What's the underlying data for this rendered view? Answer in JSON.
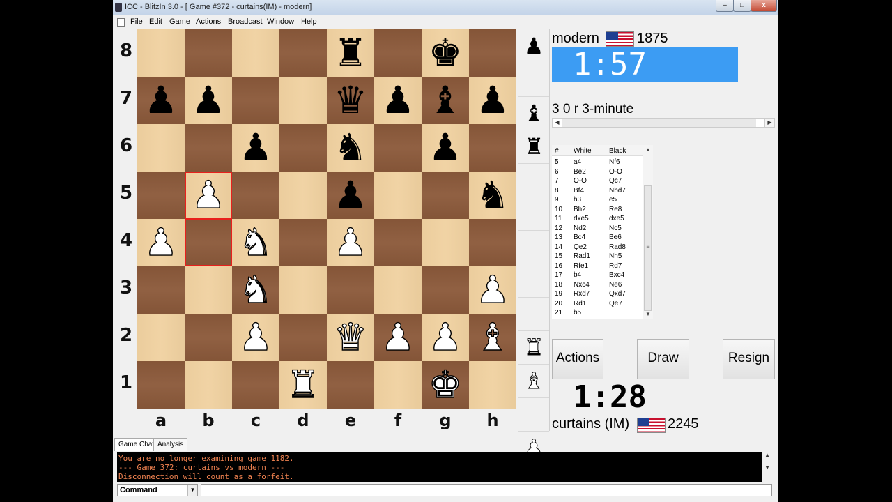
{
  "window": {
    "title": "ICC - BlitzIn 3.0 - [ Game #372 - curtains(IM) - modern]",
    "controls": {
      "minimize": "–",
      "maximize": "□",
      "close": "x"
    }
  },
  "menu": [
    "File",
    "Edit",
    "Game",
    "Actions",
    "Broadcast",
    "Window",
    "Help"
  ],
  "board": {
    "ranks": [
      "8",
      "7",
      "6",
      "5",
      "4",
      "3",
      "2",
      "1"
    ],
    "files": [
      "a",
      "b",
      "c",
      "d",
      "e",
      "f",
      "g",
      "h"
    ],
    "highlight_squares": [
      "b5",
      "b4"
    ],
    "pieces": [
      {
        "sq": "e8",
        "color": "b",
        "type": "rook"
      },
      {
        "sq": "g8",
        "color": "b",
        "type": "king"
      },
      {
        "sq": "a7",
        "color": "b",
        "type": "pawn"
      },
      {
        "sq": "b7",
        "color": "b",
        "type": "pawn"
      },
      {
        "sq": "e7",
        "color": "b",
        "type": "queen"
      },
      {
        "sq": "f7",
        "color": "b",
        "type": "pawn"
      },
      {
        "sq": "g7",
        "color": "b",
        "type": "bishop"
      },
      {
        "sq": "h7",
        "color": "b",
        "type": "pawn"
      },
      {
        "sq": "c6",
        "color": "b",
        "type": "pawn"
      },
      {
        "sq": "e6",
        "color": "b",
        "type": "knight"
      },
      {
        "sq": "g6",
        "color": "b",
        "type": "pawn"
      },
      {
        "sq": "b5",
        "color": "w",
        "type": "pawn"
      },
      {
        "sq": "e5",
        "color": "b",
        "type": "pawn"
      },
      {
        "sq": "h5",
        "color": "b",
        "type": "knight"
      },
      {
        "sq": "a4",
        "color": "w",
        "type": "pawn"
      },
      {
        "sq": "c4",
        "color": "w",
        "type": "knight"
      },
      {
        "sq": "e4",
        "color": "w",
        "type": "pawn"
      },
      {
        "sq": "c3",
        "color": "w",
        "type": "knight"
      },
      {
        "sq": "h3",
        "color": "w",
        "type": "pawn"
      },
      {
        "sq": "c2",
        "color": "w",
        "type": "pawn"
      },
      {
        "sq": "e2",
        "color": "w",
        "type": "queen"
      },
      {
        "sq": "f2",
        "color": "w",
        "type": "pawn"
      },
      {
        "sq": "g2",
        "color": "w",
        "type": "pawn"
      },
      {
        "sq": "h2",
        "color": "w",
        "type": "bishop"
      },
      {
        "sq": "d1",
        "color": "w",
        "type": "rook"
      },
      {
        "sq": "g1",
        "color": "w",
        "type": "king"
      }
    ]
  },
  "captured": {
    "top": [
      {
        "color": "b",
        "type": "pawn",
        "slot": 0
      },
      {
        "color": "b",
        "type": "bishop",
        "slot": 2
      },
      {
        "color": "b",
        "type": "rook",
        "slot": 3
      }
    ],
    "bottom": [
      {
        "color": "w",
        "type": "rook",
        "slot": 9
      },
      {
        "color": "w",
        "type": "bishop",
        "slot": 10
      },
      {
        "color": "w",
        "type": "pawn",
        "slot": 12
      }
    ]
  },
  "top_player": {
    "name": "modern",
    "flag": "us-flag",
    "rating": "1875",
    "clock": "1:57"
  },
  "bottom_player": {
    "name": "curtains (IM)",
    "flag": "us-flag",
    "rating": "2245",
    "clock": "1:28"
  },
  "game_type": "3 0 r 3-minute",
  "move_table": {
    "headers": {
      "num": "#",
      "white": "White",
      "black": "Black"
    },
    "rows": [
      {
        "num": "5",
        "white": "a4",
        "black": "Nf6"
      },
      {
        "num": "6",
        "white": "Be2",
        "black": "O-O"
      },
      {
        "num": "7",
        "white": "O-O",
        "black": "Qc7"
      },
      {
        "num": "8",
        "white": "Bf4",
        "black": "Nbd7"
      },
      {
        "num": "9",
        "white": "h3",
        "black": "e5"
      },
      {
        "num": "10",
        "white": "Bh2",
        "black": "Re8"
      },
      {
        "num": "11",
        "white": "dxe5",
        "black": "dxe5"
      },
      {
        "num": "12",
        "white": "Nd2",
        "black": "Nc5"
      },
      {
        "num": "13",
        "white": "Bc4",
        "black": "Be6"
      },
      {
        "num": "14",
        "white": "Qe2",
        "black": "Rad8"
      },
      {
        "num": "15",
        "white": "Rad1",
        "black": "Nh5"
      },
      {
        "num": "16",
        "white": "Rfe1",
        "black": "Rd7"
      },
      {
        "num": "17",
        "white": "b4",
        "black": "Bxc4"
      },
      {
        "num": "18",
        "white": "Nxc4",
        "black": "Ne6"
      },
      {
        "num": "19",
        "white": "Rxd7",
        "black": "Qxd7"
      },
      {
        "num": "20",
        "white": "Rd1",
        "black": "Qe7"
      },
      {
        "num": "21",
        "white": "b5",
        "black": ""
      }
    ]
  },
  "buttons": {
    "actions": "Actions",
    "draw": "Draw",
    "resign": "Resign"
  },
  "tabs": [
    "Game Chat",
    "Analysis"
  ],
  "chat_lines": [
    "You are no longer examining game 1182.",
    "--- Game 372: curtains vs modern ---",
    "Disconnection will count as a forfeit."
  ],
  "command_select": "Command",
  "colors": {
    "clock_active": "#3c9cf3",
    "highlight": "#e8201c",
    "light_square": "#f0d1a0",
    "dark_square": "#8c5a3b",
    "chat_text": "#f08250"
  }
}
